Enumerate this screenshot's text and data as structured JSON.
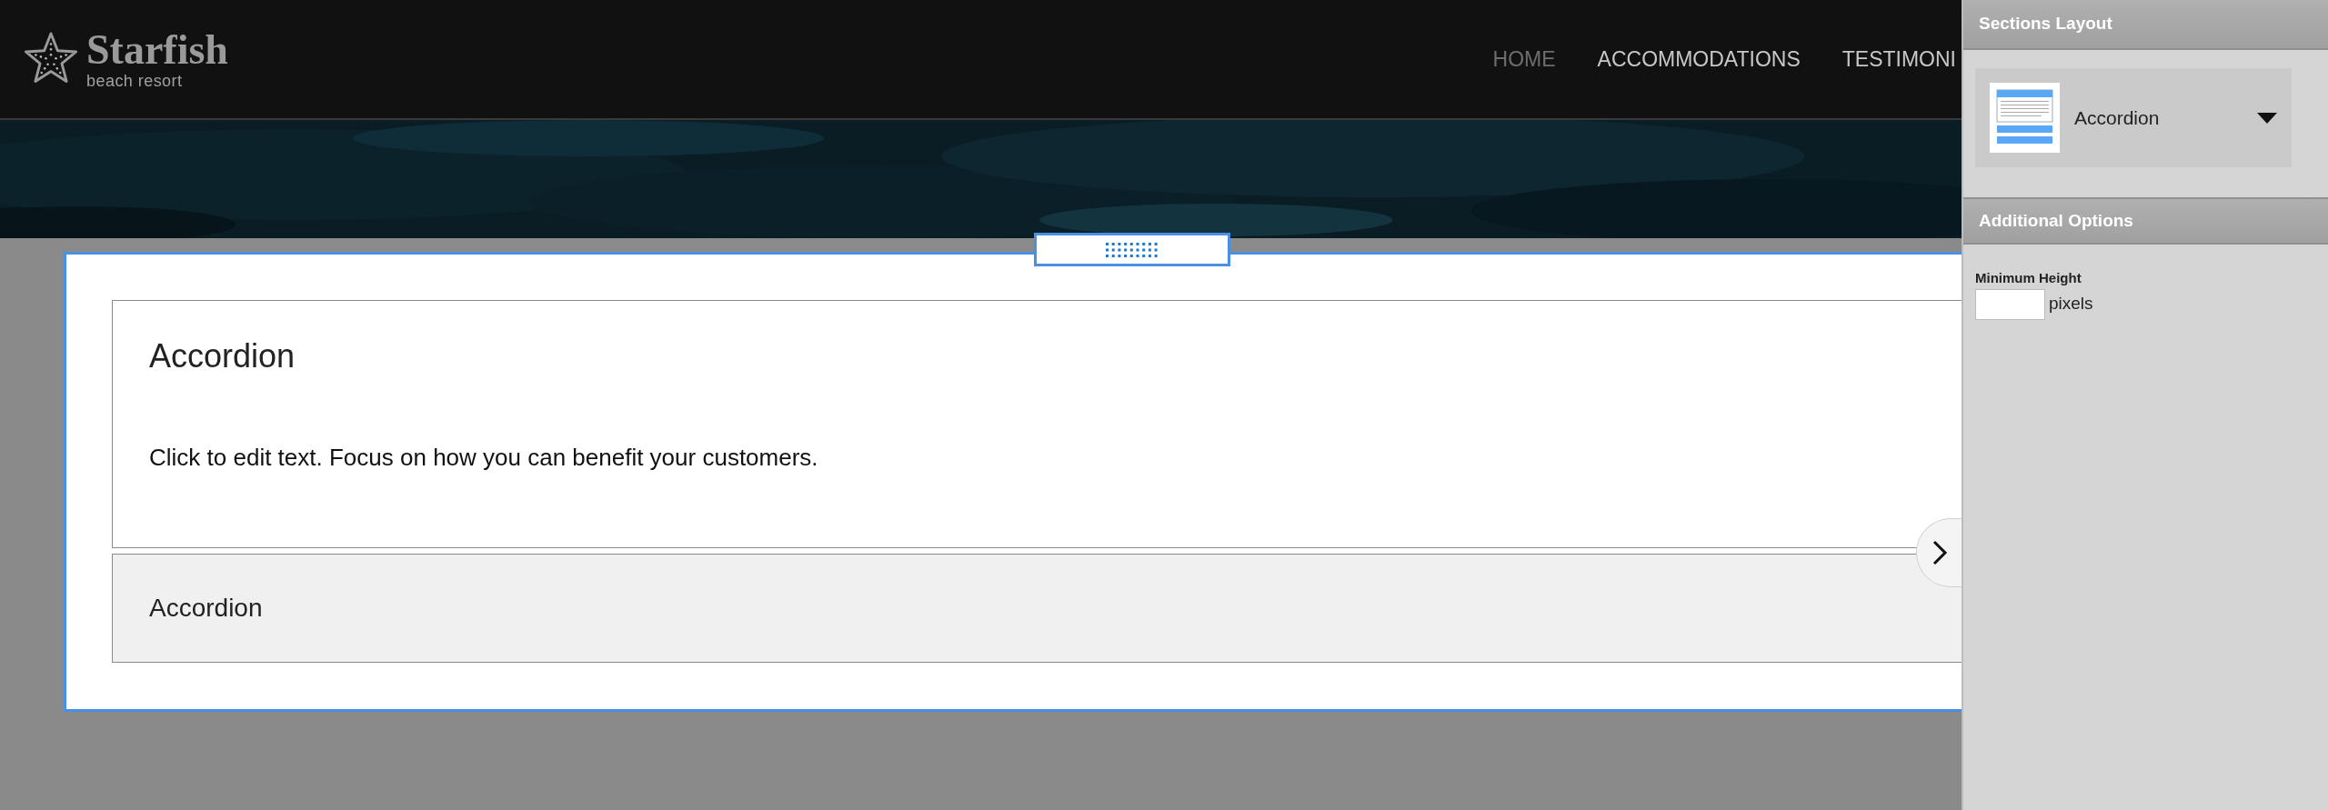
{
  "logo": {
    "name": "Starfish",
    "tagline": "beach resort"
  },
  "nav": [
    {
      "label": "HOME",
      "selected": true
    },
    {
      "label": "ACCOMMODATIONS",
      "selected": false
    },
    {
      "label": "TESTIMONI",
      "selected": false
    }
  ],
  "section": {
    "items": [
      {
        "title": "Accordion",
        "body": "Click to edit text. Focus on how you can benefit your customers.",
        "expanded": true
      },
      {
        "title": "Accordion",
        "expanded": false
      }
    ]
  },
  "panel": {
    "sections_layout": {
      "title": "Sections Layout",
      "layout": "Accordion"
    },
    "additional_options": {
      "title": "Additional Options",
      "min_height_label": "Minimum Height",
      "unit": "pixels"
    }
  }
}
